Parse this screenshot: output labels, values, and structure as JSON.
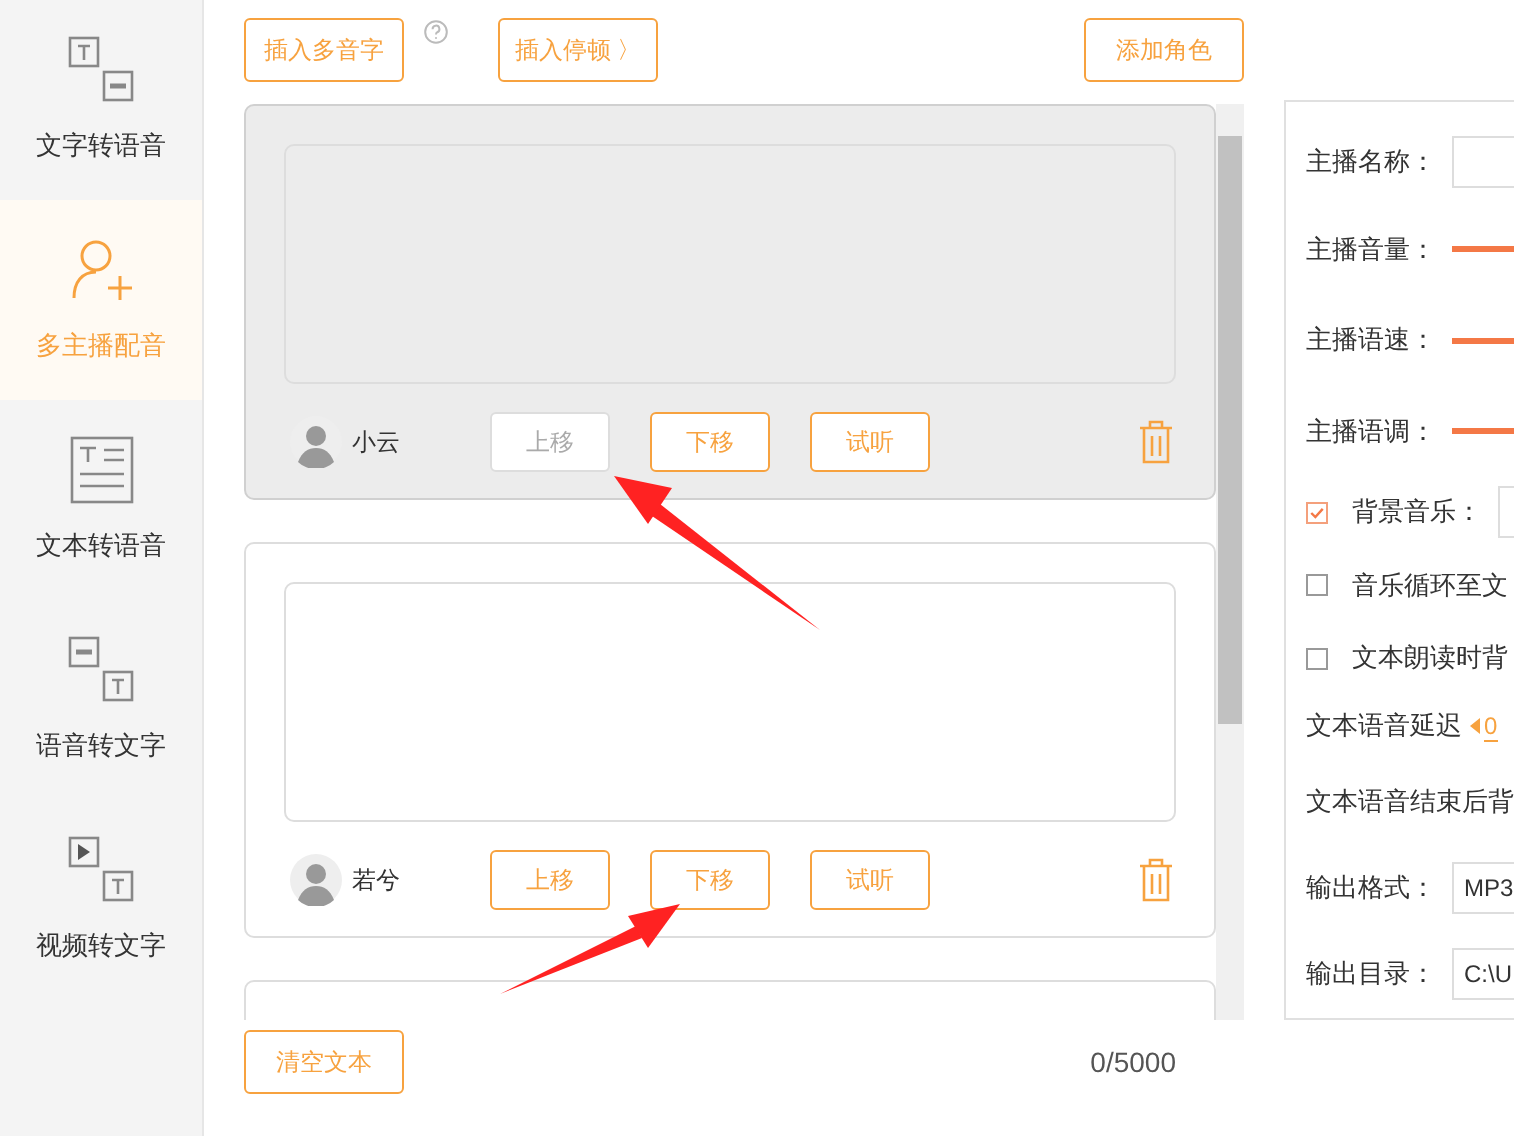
{
  "sidebar": {
    "items": [
      {
        "label": "文字转语音",
        "kind": "text-to-speech",
        "selected": false
      },
      {
        "label": "多主播配音",
        "kind": "multi-voice",
        "selected": true
      },
      {
        "label": "文本转语音",
        "kind": "document",
        "selected": false
      },
      {
        "label": "语音转文字",
        "kind": "speech-to-text",
        "selected": false
      },
      {
        "label": "视频转文字",
        "kind": "video-to-text",
        "selected": false
      }
    ]
  },
  "toolbar": {
    "polyphone_button": "插入多音字",
    "pause_button": "插入停顿 〉",
    "add_role_button": "添加角色"
  },
  "roles": [
    {
      "name": "小云",
      "selected": true,
      "buttons": [
        {
          "label": "上移",
          "disabled": true
        },
        {
          "label": "下移",
          "disabled": false
        },
        {
          "label": "试听",
          "disabled": false
        }
      ]
    },
    {
      "name": "若兮",
      "selected": false,
      "buttons": [
        {
          "label": "上移",
          "disabled": false
        },
        {
          "label": "下移",
          "disabled": false
        },
        {
          "label": "试听",
          "disabled": false
        }
      ]
    }
  ],
  "clear_button": "清空文本",
  "char_count": "0/5000",
  "settings": [
    {
      "kind": "field",
      "label": "主播名称："
    },
    {
      "kind": "slider",
      "label": "主播音量："
    },
    {
      "kind": "slider",
      "label": "主播语速："
    },
    {
      "kind": "slider",
      "label": "主播语调："
    },
    {
      "kind": "checkbox-field",
      "label": "背景音乐：",
      "checked": true
    },
    {
      "kind": "checkbox",
      "label": "音乐循环至文",
      "checked": false
    },
    {
      "kind": "checkbox",
      "label": "文本朗读时背",
      "checked": false
    },
    {
      "kind": "spinner",
      "label": "文本语音延迟",
      "value": "0"
    },
    {
      "kind": "text",
      "label": "文本语音结束后背"
    },
    {
      "kind": "field",
      "label": "输出格式：",
      "value": "MP3"
    },
    {
      "kind": "field",
      "label": "输出目录：",
      "value": "C:\\U"
    }
  ]
}
